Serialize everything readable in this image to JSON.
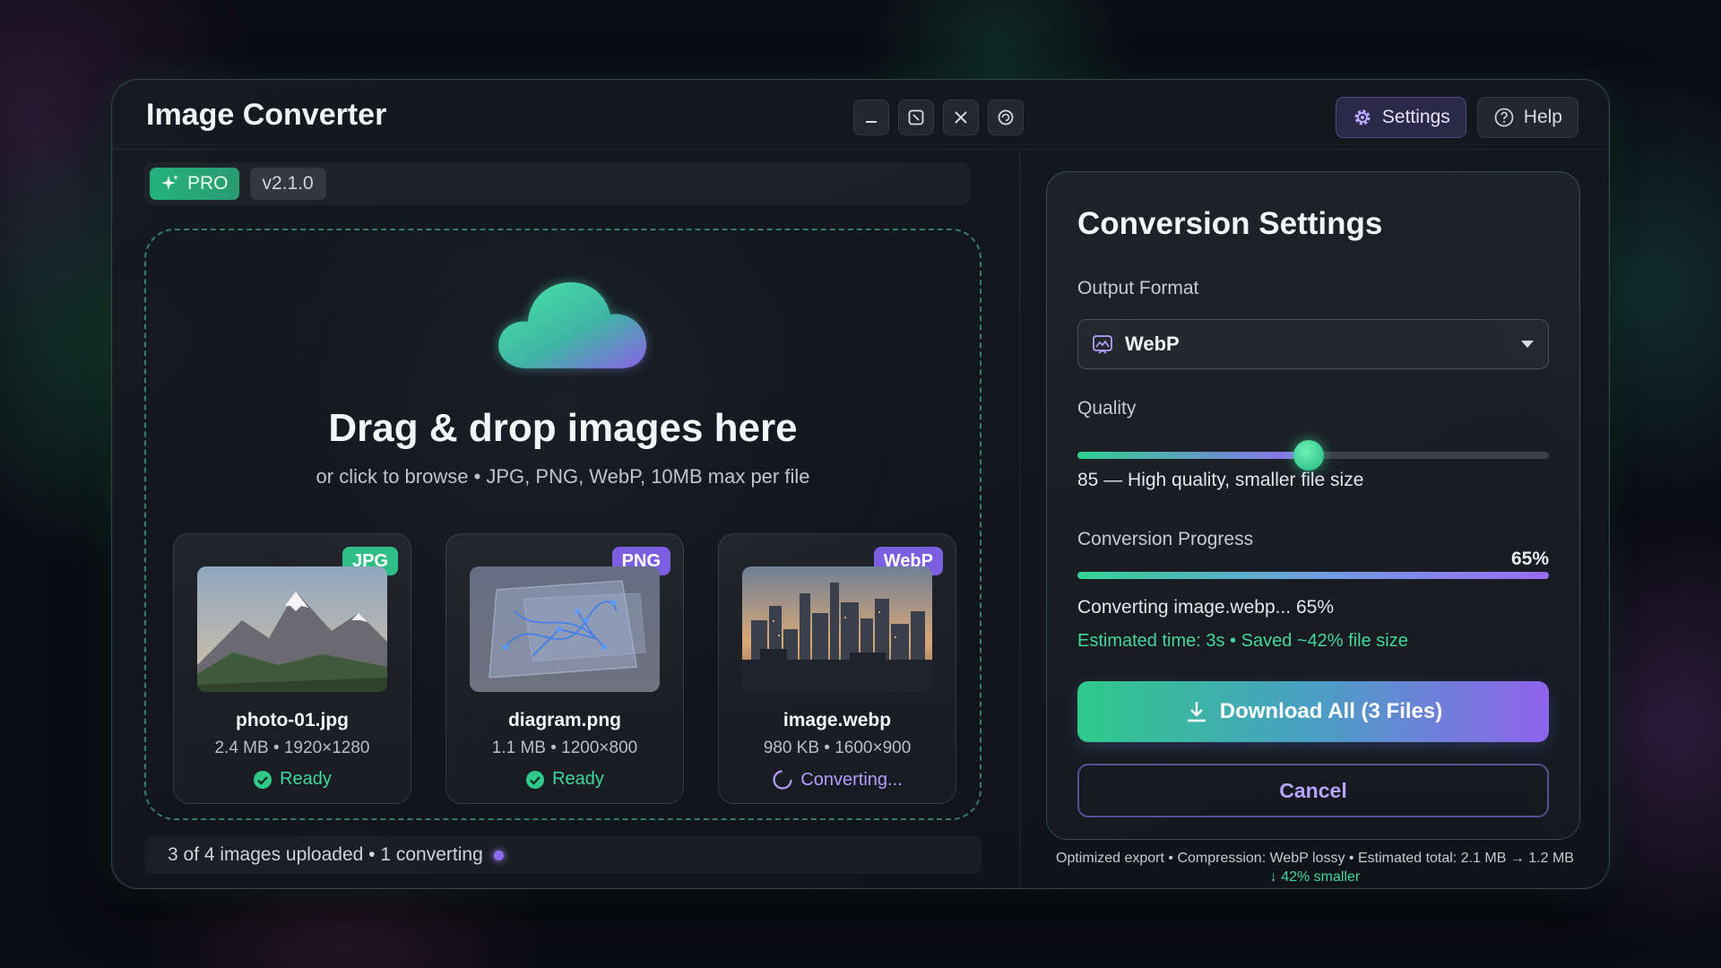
{
  "app": {
    "title": "Image Converter"
  },
  "window_controls": [
    "minimize-icon",
    "maximize-icon",
    "close-icon",
    "restore-icon"
  ],
  "header": {
    "settings_label": "Settings",
    "help_label": "Help"
  },
  "badges": {
    "pro": "PRO",
    "version": "v2.1.0"
  },
  "dropzone": {
    "title": "Drag & drop images here",
    "subtitle": "or click to browse • JPG, PNG, WebP, 10MB max per file"
  },
  "files": [
    {
      "format": "JPG",
      "format_color": "#2fbf86",
      "name": "photo-01.jpg",
      "meta": "2.4 MB • 1920×1280",
      "status": "Ready",
      "status_type": "ready",
      "thumb": "mountain"
    },
    {
      "format": "PNG",
      "format_color": "#7a5fe0",
      "name": "diagram.png",
      "meta": "1.1 MB • 1200×800",
      "status": "Ready",
      "status_type": "ready",
      "thumb": "diagram"
    },
    {
      "format": "WebP",
      "format_color": "#7a5fe0",
      "name": "image.webp",
      "meta": "980 KB • 1600×900",
      "status": "Converting...",
      "status_type": "converting",
      "thumb": "city"
    }
  ],
  "statusbar": {
    "text": "3 of 4 images uploaded • 1 converting"
  },
  "settings": {
    "title": "Conversion Settings",
    "output_format_label": "Output Format",
    "output_format_value": "WebP",
    "quality_label": "Quality",
    "quality_value": 0.49,
    "quality_text": "85 — High quality, smaller file size",
    "progress_label": "Conversion Progress",
    "progress_percent_text": "65%",
    "progress_value": 1.0,
    "converting_text": "Converting image.webp... 65%",
    "estimate_text": "Estimated time: 3s • Saved ~42% file size",
    "download_label": "Download All (3 Files)",
    "cancel_label": "Cancel"
  },
  "footer": {
    "line1": "Optimized export • Compression: WebP lossy • Estimated total: 2.1 MB → 1.2 MB",
    "line2": "↓ 42% smaller"
  },
  "colors": {
    "accent_green": "#2fd08f",
    "accent_purple": "#8f6cf0",
    "background": "#0b0c12"
  }
}
